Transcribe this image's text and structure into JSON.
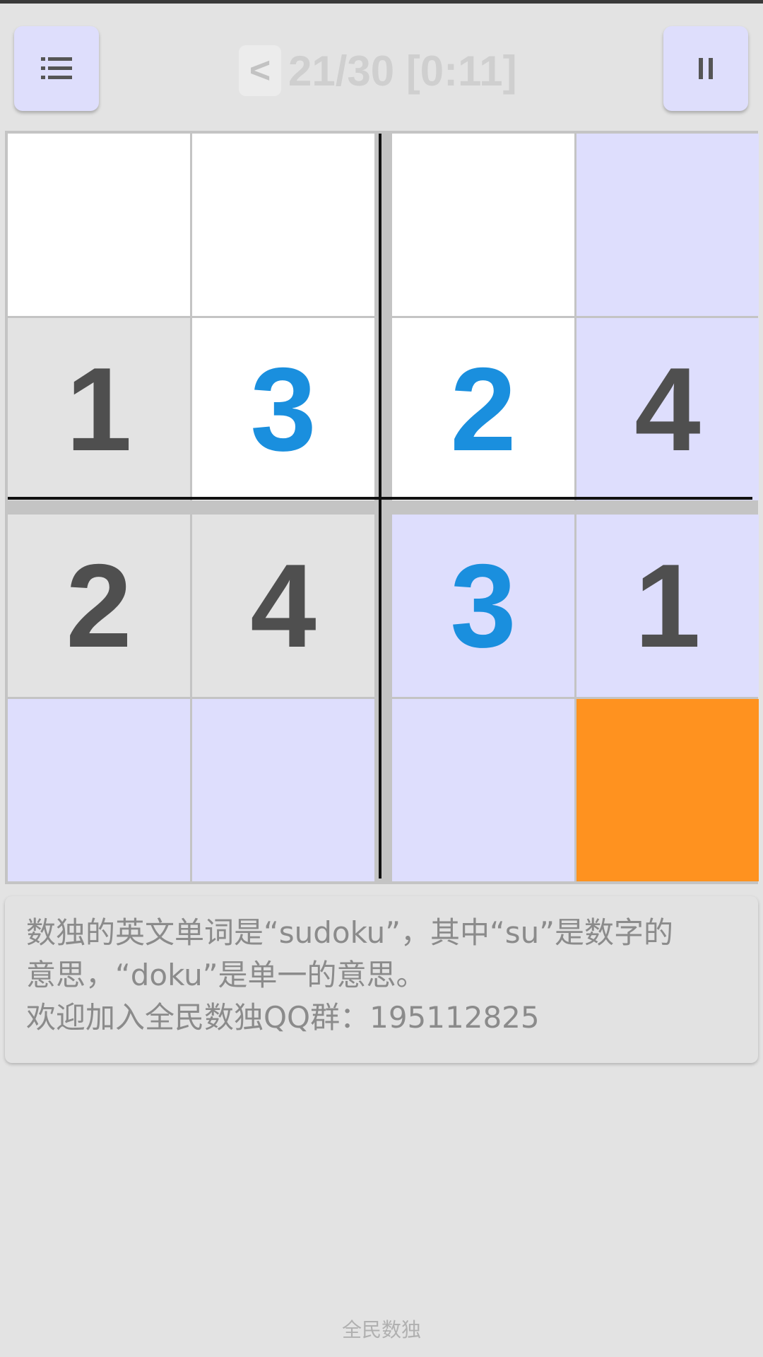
{
  "header": {
    "menu_icon": "menu-list-icon",
    "back_label": "<",
    "level_text": "21/30 [0:11]",
    "pause_icon": "pause-icon"
  },
  "board": {
    "size": 4,
    "cells": [
      [
        {
          "value": "",
          "kind": "empty",
          "bg": "#ffffff"
        },
        {
          "value": "",
          "kind": "empty",
          "bg": "#ffffff"
        },
        {
          "value": "",
          "kind": "empty",
          "bg": "#ffffff"
        },
        {
          "value": "",
          "kind": "empty",
          "bg": "#dedefd"
        }
      ],
      [
        {
          "value": "1",
          "kind": "given",
          "bg": "#e3e3e3"
        },
        {
          "value": "3",
          "kind": "filled",
          "bg": "#ffffff"
        },
        {
          "value": "2",
          "kind": "filled",
          "bg": "#ffffff"
        },
        {
          "value": "4",
          "kind": "given",
          "bg": "#dedefd"
        }
      ],
      [
        {
          "value": "2",
          "kind": "given",
          "bg": "#e3e3e3"
        },
        {
          "value": "4",
          "kind": "given",
          "bg": "#e3e3e3"
        },
        {
          "value": "3",
          "kind": "filled",
          "bg": "#dedefd"
        },
        {
          "value": "1",
          "kind": "given",
          "bg": "#dedefd"
        }
      ],
      [
        {
          "value": "",
          "kind": "empty",
          "bg": "#dedefd"
        },
        {
          "value": "",
          "kind": "empty",
          "bg": "#dedefd"
        },
        {
          "value": "",
          "kind": "empty",
          "bg": "#dedefd"
        },
        {
          "value": "",
          "kind": "selected",
          "bg": "#ff921f"
        }
      ]
    ]
  },
  "tip": {
    "lines": [
      "数独的英文单词是“sudoku”，其中“su”是数字的",
      "意思，“doku”是单一的意思。",
      "欢迎加入全民数独QQ群：195112825"
    ]
  },
  "footer": {
    "label": "全民数独"
  },
  "colors": {
    "given_digit": "#4f4f4f",
    "filled_digit": "#1a8fde",
    "selected_cell": "#ff921f",
    "highlight_cell": "#dedefd",
    "button_bg": "#dedefc"
  }
}
